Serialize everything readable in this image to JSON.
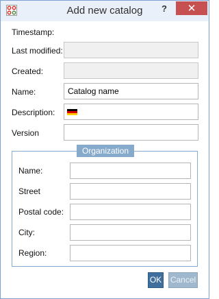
{
  "window": {
    "title": "Add new catalog",
    "help_label": "?",
    "close_label": "✕",
    "app_icon": "catalog-app-icon"
  },
  "form": {
    "timestamp_label": "Timestamp:",
    "last_modified_label": "Last modified:",
    "last_modified_value": "",
    "created_label": "Created:",
    "created_value": "",
    "name_label": "Name:",
    "name_value": "Catalog name",
    "description_label": "Description:",
    "description_language_icon": "german-flag-icon",
    "version_label": "Version",
    "version_value": ""
  },
  "organization": {
    "legend": "Organization",
    "name_label": "Name:",
    "street_label": "Street",
    "postal_code_label": "Postal code:",
    "city_label": "City:",
    "region_label": "Region:"
  },
  "buttons": {
    "ok_label": "OK",
    "cancel_label": "Cancel"
  },
  "colors": {
    "accent": "#86aacb",
    "ok_button": "#3f6f9c",
    "close_button": "#c75050"
  }
}
